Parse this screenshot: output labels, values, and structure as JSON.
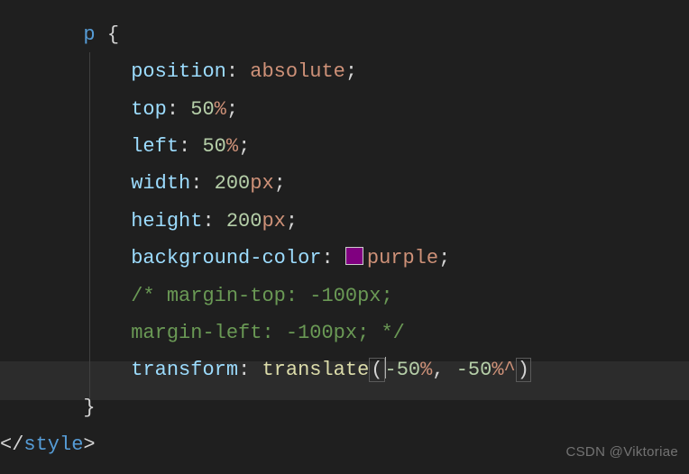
{
  "code": {
    "selector": "p",
    "brace_open": " {",
    "brace_close": "}",
    "close_tag_open": "</",
    "close_tag_name": "style",
    "close_tag_close": ">",
    "props": {
      "position": {
        "name": "position",
        "value": "absolute"
      },
      "top": {
        "name": "top",
        "num": "50",
        "unit": "%"
      },
      "left": {
        "name": "left",
        "num": "50",
        "unit": "%"
      },
      "width": {
        "name": "width",
        "num": "200",
        "unit": "px"
      },
      "height": {
        "name": "height",
        "num": "200",
        "unit": "px"
      },
      "bg": {
        "name": "background-color",
        "value": "purple"
      },
      "comment": "/* margin-top: -100px;",
      "comment2": "margin-left: -100px; */",
      "transform": {
        "name": "transform",
        "func": "translate",
        "a1": "-50",
        "a1u": "%",
        "a2": "-50",
        "a2u": "%^"
      }
    },
    "semi": ";",
    "colon": ":",
    "comma": ",",
    "lparen": "(",
    "rparen": ")"
  },
  "watermark": "CSDN @Viktoriae"
}
